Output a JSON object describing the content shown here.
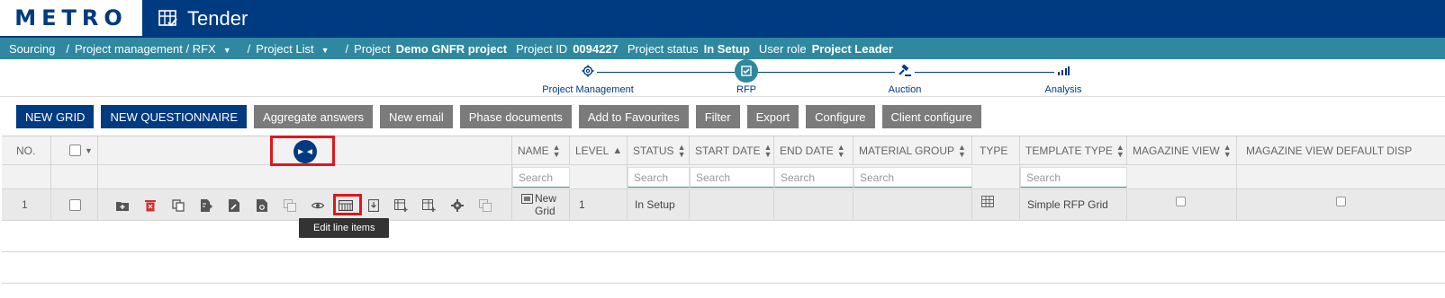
{
  "app": {
    "logo": "METRO",
    "title": "Tender"
  },
  "breadcrumb": {
    "sourcing": "Sourcing",
    "project_mgmt": "Project management / RFX",
    "project_list": "Project List",
    "project_label": "Project",
    "project_name": "Demo GNFR project",
    "project_id_label": "Project ID",
    "project_id": "0094227",
    "status_label": "Project status",
    "status": "In Setup",
    "role_label": "User role",
    "role": "Project Leader"
  },
  "steps": [
    {
      "label": "Project Management",
      "icon": "gear-icon"
    },
    {
      "label": "RFP",
      "icon": "rfp-icon"
    },
    {
      "label": "Auction",
      "icon": "gavel-icon"
    },
    {
      "label": "Analysis",
      "icon": "bar-chart-icon"
    }
  ],
  "toolbar": {
    "new_grid": "NEW GRID",
    "new_questionnaire": "NEW QUESTIONNAIRE",
    "aggregate": "Aggregate answers",
    "new_email": "New email",
    "phase_docs": "Phase documents",
    "favourites": "Add to Favourites",
    "filter": "Filter",
    "export": "Export",
    "configure": "Configure",
    "client_configure": "Client configure"
  },
  "columns": {
    "no": "NO.",
    "name": "NAME",
    "level": "LEVEL",
    "status": "STATUS",
    "start_date": "START DATE",
    "end_date": "END DATE",
    "material_group": "MATERIAL GROUP",
    "type": "TYPE",
    "template_type": "TEMPLATE TYPE",
    "magazine_view": "MAGAZINE VIEW",
    "magazine_default": "MAGAZINE VIEW DEFAULT DISP"
  },
  "search_placeholder": "Search",
  "rows": [
    {
      "no": "1",
      "name_line1": "New",
      "name_line2": "Grid",
      "level": "1",
      "status": "In Setup",
      "template_type": "Simple RFP Grid"
    }
  ],
  "tooltip": "Edit line items",
  "colors": {
    "brand": "#003a80",
    "teal": "#2f88a0",
    "highlight": "#e0161d",
    "grey_button": "#7b7b7b"
  }
}
